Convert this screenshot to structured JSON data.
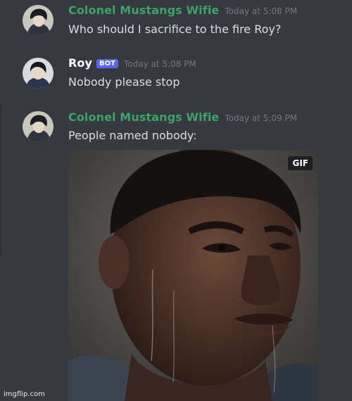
{
  "messages": [
    {
      "author": "Colonel Mustangs Wifie",
      "timestamp": "Today at 5:08 PM",
      "text": "Who should I sacrifice to the fire Roy?",
      "name_color": "#3aa567"
    },
    {
      "author": "Roy",
      "badge": "BOT",
      "timestamp": "Today at 5:08 PM",
      "text": "Nobody please stop",
      "name_color": "#ffffff"
    },
    {
      "author": "Colonel Mustangs Wifie",
      "timestamp": "Today at 5:09 PM",
      "text": "People named nobody:",
      "name_color": "#3aa567",
      "attachment": {
        "type": "gif",
        "badge": "GIF"
      }
    }
  ],
  "watermark": "imgflip.com",
  "colors": {
    "background": "#36393f",
    "bot_badge": "#5865f2",
    "timestamp": "#72767d"
  }
}
